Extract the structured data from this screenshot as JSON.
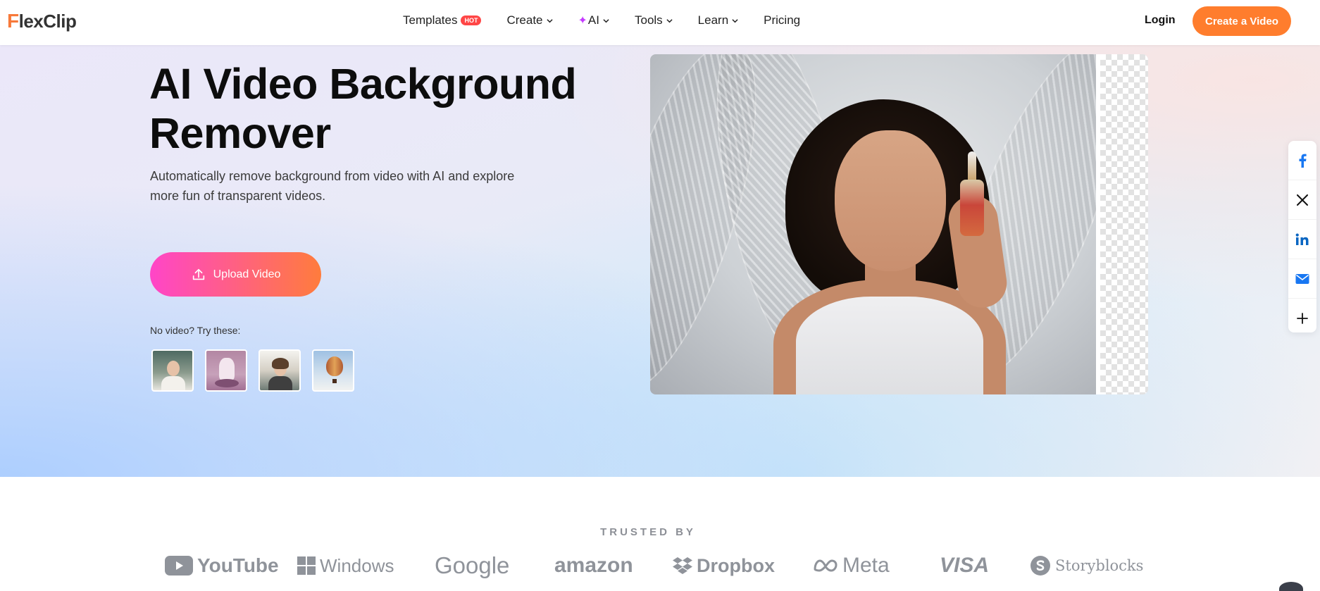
{
  "nav": {
    "logo": "FlexClip",
    "items": [
      {
        "label": "Templates",
        "badge": "HOT"
      },
      {
        "label": "Create"
      },
      {
        "label": "AI"
      },
      {
        "label": "Tools"
      },
      {
        "label": "Learn"
      },
      {
        "label": "Pricing"
      }
    ],
    "login": "Login",
    "cta": "Create a Video"
  },
  "hero": {
    "title": "AI Video Background Remover",
    "subtitle": "Automatically remove background from video with AI and explore more fun of transparent videos.",
    "upload_label": "Upload Video",
    "try_label": "No video? Try these:"
  },
  "share": [
    "facebook-icon",
    "x-icon",
    "linkedin-icon",
    "mail-icon",
    "plus-icon"
  ],
  "trusted": {
    "label": "TRUSTED BY",
    "brands": [
      "YouTube",
      "Windows",
      "Google",
      "amazon",
      "Dropbox",
      "Meta",
      "VISA",
      "Storyblocks"
    ]
  },
  "colors": {
    "accent": "#ff7d2d",
    "upload_start": "#ff45c8",
    "upload_end": "#ff7c3c",
    "hot_badge": "#ff4646"
  }
}
